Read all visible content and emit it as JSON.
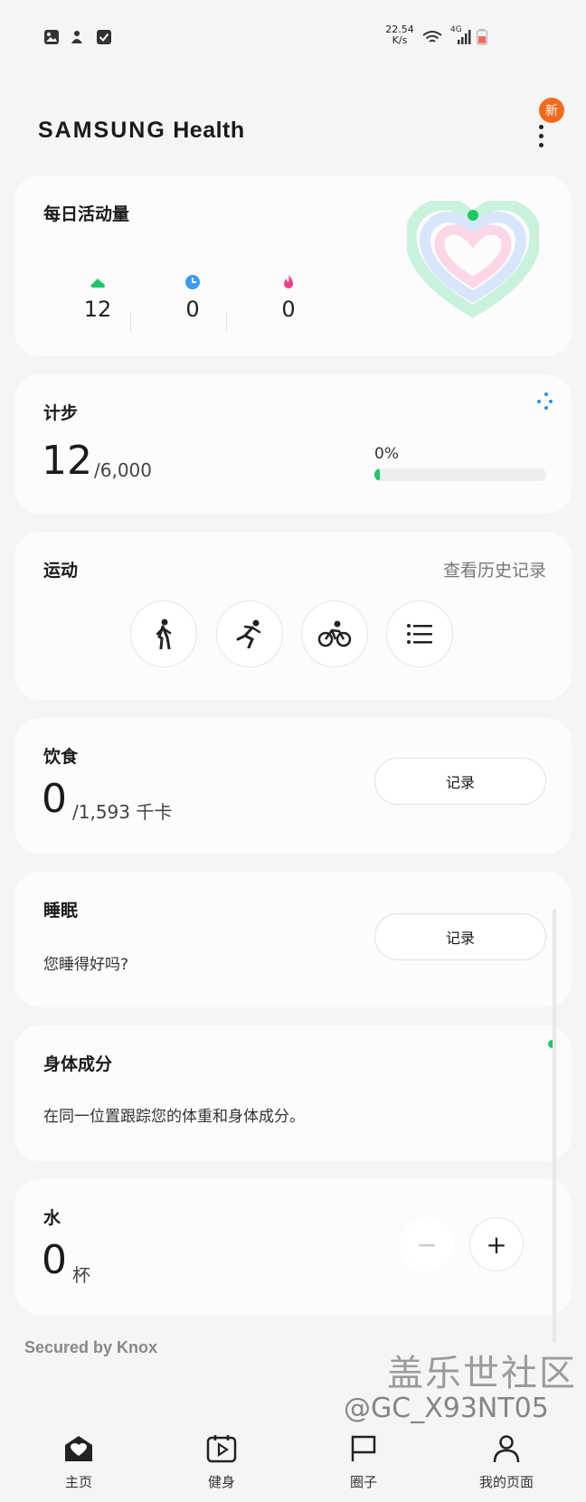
{
  "status_bar": {
    "speed_value": "22.54",
    "speed_unit": "K/s",
    "network": "4G",
    "icons": [
      "gallery-icon",
      "app-icon",
      "checkbox-icon",
      "wifi-icon",
      "signal-icon",
      "battery-icon"
    ]
  },
  "header": {
    "brand": "SAMSUNG",
    "product": "Health",
    "new_badge": "新"
  },
  "daily_activity": {
    "title": "每日活动量",
    "steps": "12",
    "active_minutes": "0",
    "calories": "0",
    "colors": {
      "steps": "#1cc866",
      "minutes": "#3a9af5",
      "calories": "#f0408a"
    }
  },
  "steps": {
    "title": "计步",
    "value": "12",
    "goal": "/6,000",
    "percent_label": "0%",
    "progress_fraction": 0.03
  },
  "exercise": {
    "title": "运动",
    "history_link": "查看历史记录",
    "buttons": [
      "walk-icon",
      "run-icon",
      "cycle-icon",
      "list-icon"
    ]
  },
  "food": {
    "title": "饮食",
    "value": "0",
    "goal": "/1,593 千卡",
    "record_label": "记录"
  },
  "sleep": {
    "title": "睡眠",
    "prompt": "您睡得好吗?",
    "record_label": "记录"
  },
  "body_composition": {
    "title": "身体成分",
    "description": "在同一位置跟踪您的体重和身体成分。"
  },
  "water": {
    "title": "水",
    "value": "0",
    "unit": "杯",
    "minus": "−",
    "plus": "+"
  },
  "footer": {
    "secured": "Secured by Knox"
  },
  "bottom_nav": {
    "home": "主页",
    "fitness": "健身",
    "groups": "圈子",
    "my_page": "我的页面"
  },
  "watermark": {
    "site": "盖乐世社区",
    "user": "@GC_X93NT05"
  },
  "accent_colors": {
    "green": "#1cc866",
    "orange": "#f26b1d"
  }
}
